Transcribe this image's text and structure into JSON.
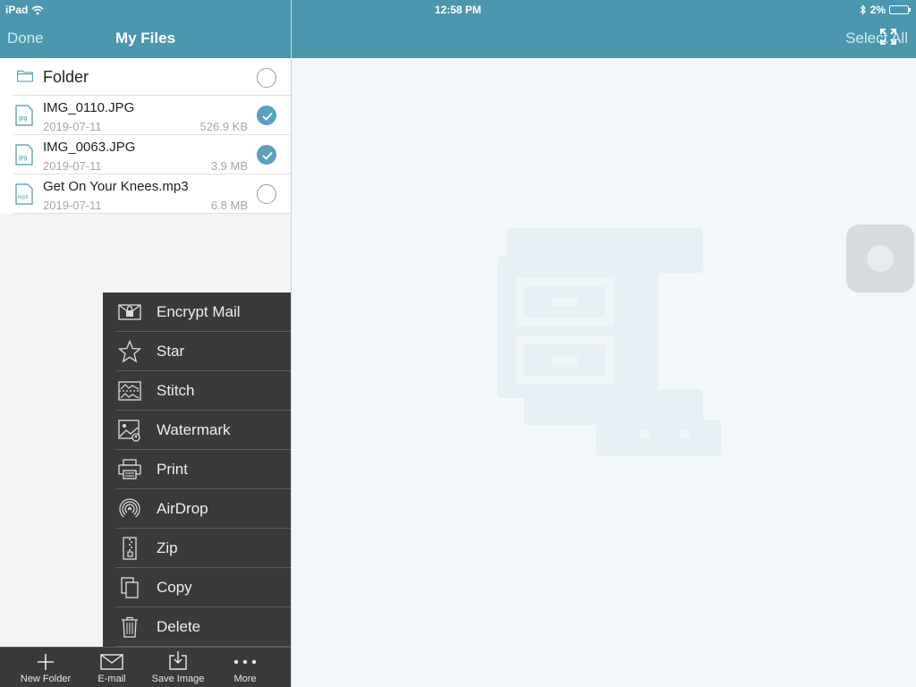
{
  "status": {
    "carrier": "iPad",
    "time": "12:58 PM",
    "battery": "2%"
  },
  "nav": {
    "done_label": "Done",
    "title": "My Files",
    "select_all_label": "Select All"
  },
  "files": [
    {
      "name": "Folder",
      "type": "folder",
      "checked": false
    },
    {
      "name": "IMG_0110.JPG",
      "type": "jpg",
      "date": "2019-07-11",
      "size": "526.9 KB",
      "checked": true
    },
    {
      "name": "IMG_0063.JPG",
      "type": "jpg",
      "date": "2019-07-11",
      "size": "3.9 MB",
      "checked": true
    },
    {
      "name": "Get On Your Knees.mp3",
      "type": "mp3",
      "date": "2019-07-11",
      "size": "6.8 MB",
      "checked": false
    }
  ],
  "file_icon_labels": {
    "jpg": "jpg",
    "mp3": "mp3"
  },
  "menu": [
    {
      "label": "Encrypt Mail",
      "icon": "encrypt-mail-icon"
    },
    {
      "label": "Star",
      "icon": "star-icon"
    },
    {
      "label": "Stitch",
      "icon": "stitch-icon"
    },
    {
      "label": "Watermark",
      "icon": "watermark-icon"
    },
    {
      "label": "Print",
      "icon": "printer-icon"
    },
    {
      "label": "AirDrop",
      "icon": "airdrop-icon"
    },
    {
      "label": "Zip",
      "icon": "zip-icon"
    },
    {
      "label": "Copy",
      "icon": "copy-icon"
    },
    {
      "label": "Delete",
      "icon": "trash-icon"
    }
  ],
  "toolbar": [
    {
      "label": "New Folder",
      "icon": "plus-icon"
    },
    {
      "label": "E-mail",
      "icon": "envelope-icon"
    },
    {
      "label": "Save Image",
      "icon": "save-image-icon"
    },
    {
      "label": "More",
      "icon": "more-dots-icon"
    }
  ],
  "colors": {
    "header": "#4d97ae",
    "check_on": "#5aa0c0",
    "menu_bg": "#3a3a3a"
  }
}
